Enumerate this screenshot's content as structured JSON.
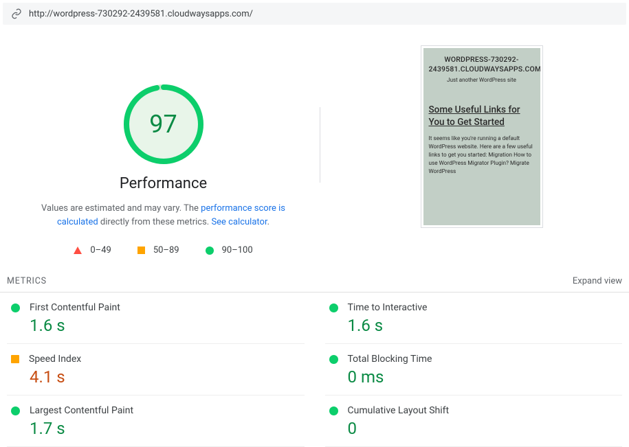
{
  "url": "http://wordpress-730292-2439581.cloudwaysapps.com/",
  "gauge": {
    "score": "97",
    "percent": 97
  },
  "perf_title": "Performance",
  "perf_desc_prefix": "Values are estimated and may vary. The ",
  "perf_desc_link1": "performance score is calculated",
  "perf_desc_mid": " directly from these metrics. ",
  "perf_desc_link2": "See calculator",
  "perf_desc_suffix": ".",
  "legend": {
    "fail": "0–49",
    "avg": "50–89",
    "pass": "90–100"
  },
  "preview": {
    "title": "WORDPRESS-730292-2439581.CLOUDWAYSAPPS.COM",
    "subtitle": "Just another WordPress site",
    "heading": "Some Useful Links for You to Get Started",
    "body": "It seems like you're running a default WordPress website. Here are a few useful links to get you started: Migration How to use WordPress Migrator Plugin? Migrate WordPress"
  },
  "metrics_header": "METRICS",
  "expand_label": "Expand view",
  "metrics": {
    "fcp": {
      "name": "First Contentful Paint",
      "value": "1.6 s",
      "status": "pass"
    },
    "tti": {
      "name": "Time to Interactive",
      "value": "1.6 s",
      "status": "pass"
    },
    "si": {
      "name": "Speed Index",
      "value": "4.1 s",
      "status": "avg"
    },
    "tbt": {
      "name": "Total Blocking Time",
      "value": "0 ms",
      "status": "pass"
    },
    "lcp": {
      "name": "Largest Contentful Paint",
      "value": "1.7 s",
      "status": "pass"
    },
    "cls": {
      "name": "Cumulative Layout Shift",
      "value": "0",
      "status": "pass"
    }
  }
}
